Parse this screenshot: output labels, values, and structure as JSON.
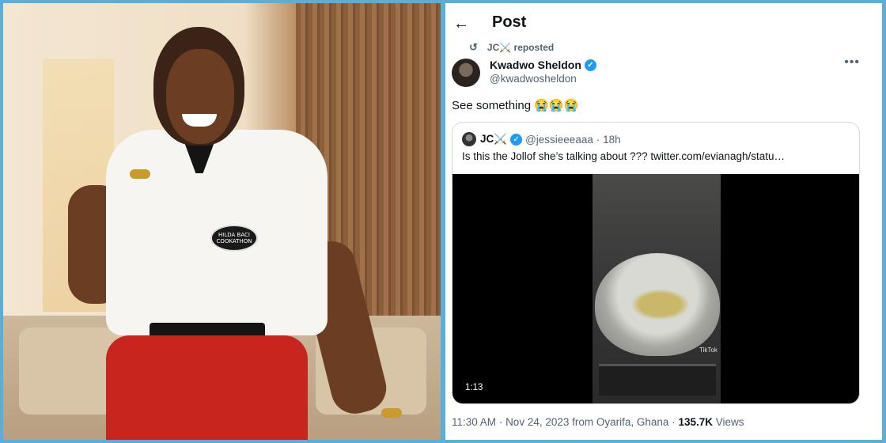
{
  "post": {
    "back_icon": "arrow-left-icon",
    "title": "Post",
    "repost_line": "JC⚔️ reposted",
    "repost_icon": "retweet-icon",
    "author": {
      "name": "Kwadwo Sheldon",
      "handle": "@kwadwosheldon",
      "verified": true
    },
    "more_icon": "more-horizontal-icon",
    "text": "See something 😭😭😭",
    "quote": {
      "author_name": "JC⚔️",
      "author_handle": "@jessieeeaaa",
      "time_ago": "· 18h",
      "verified": true,
      "text": "Is this the Jollof she’s talking about ??? ",
      "link": "twitter.com/evianagh/statu…",
      "video": {
        "duration": "1:13",
        "watermark": "TikTok"
      }
    },
    "meta": {
      "time": "11:30 AM",
      "date": "Nov 24, 2023",
      "location": "from Oyarifa, Ghana",
      "views_count": "135.7K",
      "views_label": "Views"
    }
  },
  "photo": {
    "badge_text": "HILDA BACI COOKATHON"
  },
  "colors": {
    "frame": "#5aaed8",
    "verified": "#1d9bf0",
    "secondary_text": "#536471",
    "skirt": "#c8251f"
  }
}
